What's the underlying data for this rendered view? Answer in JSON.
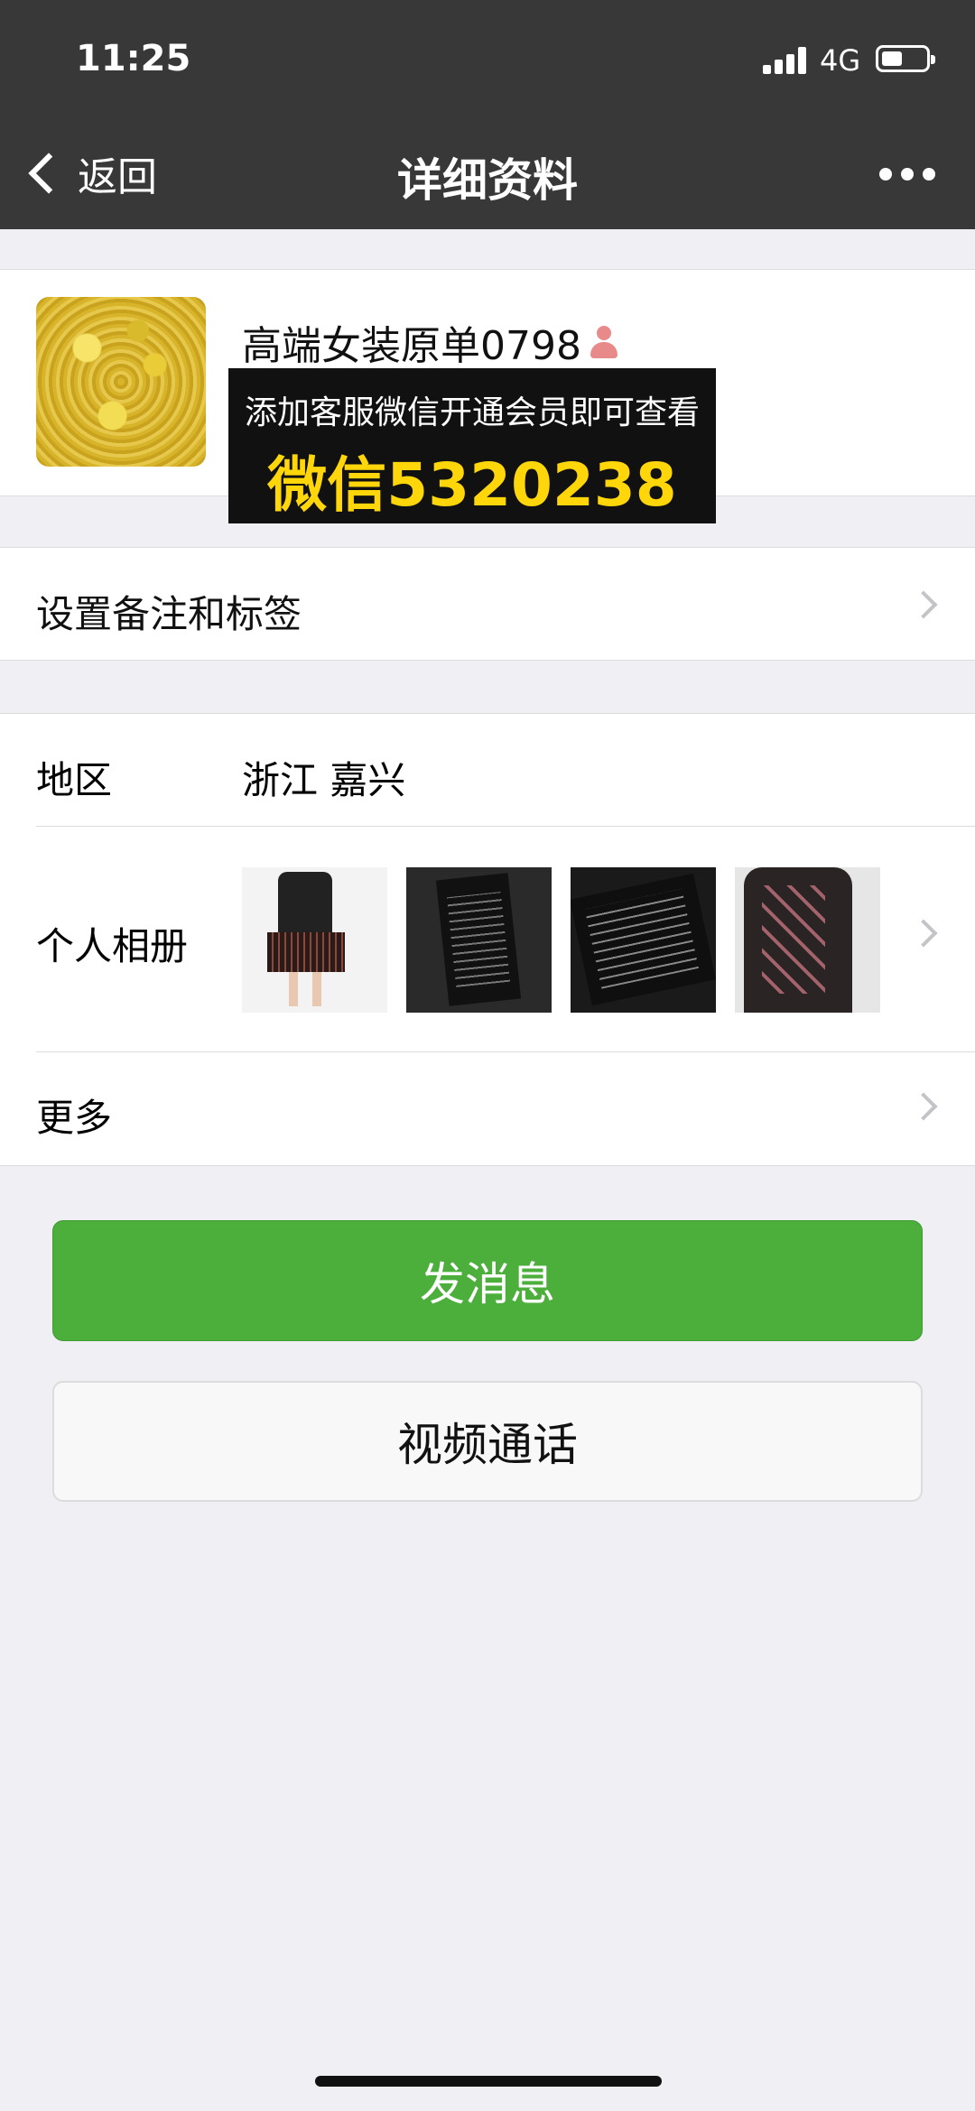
{
  "status_bar": {
    "time": "11:25",
    "network": "4G"
  },
  "nav": {
    "back_label": "返回",
    "title": "详细资料",
    "more_icon": "more-dots-icon"
  },
  "profile": {
    "nickname": "高端女装原单0798",
    "gender_icon": "female-person-icon"
  },
  "promo": {
    "line1": "添加客服微信开通会员即可查看",
    "line2": "微信5320238",
    "accent": "#ffd60a"
  },
  "remark": {
    "label": "设置备注和标签"
  },
  "info": {
    "region_label": "地区",
    "region_value": "浙江  嘉兴",
    "album_label": "个人相册",
    "more_label": "更多"
  },
  "buttons": {
    "message": "发消息",
    "video_call": "视频通话",
    "message_color": "#4cae3b"
  }
}
